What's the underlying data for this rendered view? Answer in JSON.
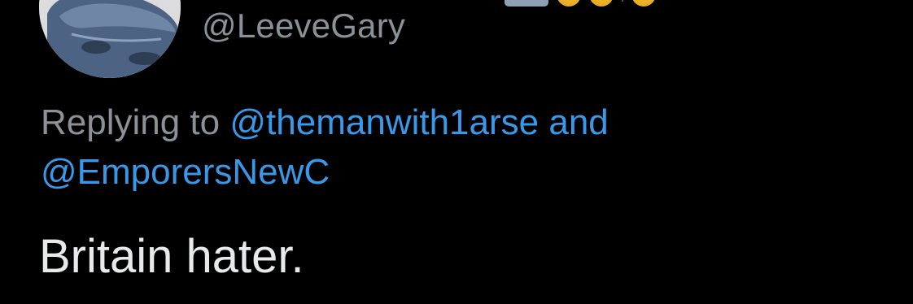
{
  "tweet": {
    "author": {
      "handle": "@LeeveGary"
    },
    "replying_to": {
      "prefix": "Replying to",
      "mention_1": "@themanwith1arse",
      "conjunction": "and",
      "mention_2": "@EmporersNewC"
    },
    "text": "Britain hater."
  },
  "colors": {
    "background": "#000000",
    "secondary_text": "#8b9197",
    "link": "#3a98e8",
    "primary_text": "#e7e9ea"
  },
  "icons": {
    "avatar": "profile-photo",
    "name_decorations": [
      "flag-badge",
      "emoji",
      "emoji",
      "emoji"
    ]
  }
}
